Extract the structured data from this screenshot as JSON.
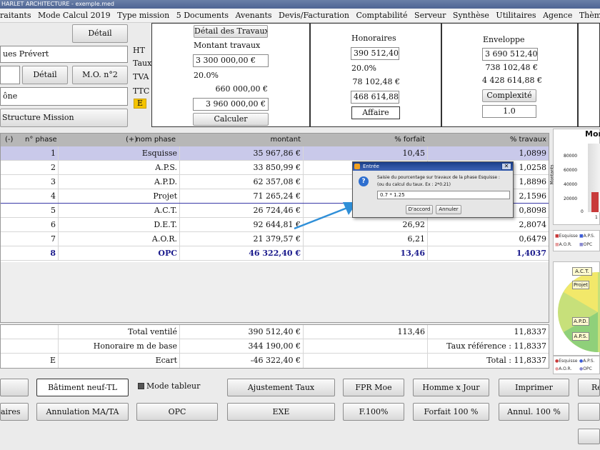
{
  "window": {
    "title": "HARLET ARCHITECTURE - exemple.med"
  },
  "menu": [
    "raitants",
    "Mode Calcul 2019",
    "Type mission",
    "5 Documents",
    "Avenants",
    "Devis/Facturation",
    "Comptabilité",
    "Serveur",
    "Synthèse",
    "Utilitaires",
    "Agence",
    "Thème",
    "?"
  ],
  "left_panel": {
    "detail_button": "Détail",
    "client_name": "ues Prévert",
    "detail_button_2": "Détail",
    "mo_button": "M.O. n°2",
    "city": "ône",
    "structure_button": "Structure Mission"
  },
  "travaux": {
    "detail_button": "Détail des Travaux",
    "montant_label": "Montant travaux",
    "labels": {
      "ht": "HT",
      "taux": "Taux",
      "tva": "TVA",
      "ttc": "TTC",
      "e": "E"
    },
    "ht_value": "3 300 000,00 €",
    "tva_rate": "20.0%",
    "tva_value": "660 000,00 €",
    "ttc_value": "3 960 000,00 €",
    "calc_button": "Calculer"
  },
  "honoraires": {
    "title": "Honoraires",
    "ht_value": "390 512,40 €",
    "tva_rate": "20.0%",
    "tva_value": "78 102,48 €",
    "ttc_value": "468 614,88 €",
    "affaire_button": "Affaire"
  },
  "enveloppe": {
    "title": "Enveloppe",
    "ht_value": "3 690 512,40 €",
    "tva_value": "738 102,48 €",
    "ttc_value": "4 428 614,88 €",
    "complexite_button": "Complexité",
    "complexite_value": "1.0"
  },
  "table": {
    "headers": [
      "(-)",
      "n° phase",
      "(+)",
      "nom phase",
      "montant",
      "% forfait",
      "% travaux"
    ],
    "rows": [
      {
        "num": "1",
        "name": "Esquisse",
        "montant": "35 967,86 €",
        "forfait": "10,45",
        "travaux": "1,0899"
      },
      {
        "num": "2",
        "name": "A.P.S.",
        "montant": "33 850,99 €",
        "forfait": "",
        "travaux": "1,0258"
      },
      {
        "num": "3",
        "name": "A.P.D.",
        "montant": "62 357,08 €",
        "forfait": "",
        "travaux": "1,8896"
      },
      {
        "num": "4",
        "name": "Projet",
        "montant": "71 265,24 €",
        "forfait": "",
        "travaux": "2,1596"
      },
      {
        "num": "5",
        "name": "A.C.T.",
        "montant": "26 724,46 €",
        "forfait": "",
        "travaux": "0,8098"
      },
      {
        "num": "6",
        "name": "D.E.T.",
        "montant": "92 644,81 €",
        "forfait": "26,92",
        "travaux": "2,8074"
      },
      {
        "num": "7",
        "name": "A.O.R.",
        "montant": "21 379,57 €",
        "forfait": "6,21",
        "travaux": "0,6479"
      },
      {
        "num": "8",
        "name": "OPC",
        "montant": "46 322,40 €",
        "forfait": "13,46",
        "travaux": "1,4037"
      }
    ]
  },
  "totals": {
    "row1": {
      "label": "Total ventilé",
      "montant": "390 512,40 €",
      "forfait": "113,46",
      "travaux": "11,8337"
    },
    "row2": {
      "label": "Honoraire m de base",
      "montant": "344 190,00 €",
      "right": "Taux référence : 11,8337"
    },
    "row3": {
      "left": "E",
      "label": "Ecart",
      "montant": "-46 322,40 €",
      "right": "Total : 11,8337"
    }
  },
  "buttons_row1": [
    "Bâtiment neuf-TL",
    "Mode tableur",
    "Ajustement Taux",
    "FPR Moe",
    "Homme x Jour",
    "Imprimer",
    "Ré"
  ],
  "buttons_row2": [
    "aires",
    "Annulation MA/TA",
    "OPC",
    "EXE",
    "F.100%",
    "Forfait 100 %",
    "Annul. 100 %"
  ],
  "dialog": {
    "title": "Entrée",
    "message_line1": "Saisie du pourcentage sur travaux de la phase Esquisse :",
    "message_line2": "(ou du calcul du taux. Ex : 2*0.21)",
    "input_value": "0.7 * 1.25",
    "ok_button": "D'accord",
    "cancel_button": "Annuler",
    "close_glyph": "✕"
  },
  "bar_chart": {
    "title": "Mon",
    "ylabel": "Montants",
    "ticks": [
      "80000",
      "60000",
      "40000",
      "20000",
      "0"
    ],
    "xtick": "1",
    "legend": [
      "Esquisse",
      "A.P.S.",
      "A.O.R.",
      "OPC"
    ]
  },
  "pie_chart": {
    "labels": [
      "A.C.T.",
      "Projet",
      "A.P.D.",
      "A.P.S."
    ],
    "legend": [
      "Esquisse",
      "A.P.S.",
      "A.O.R.",
      "OPC"
    ]
  },
  "colors": {
    "header_bg": "#b7b7b7",
    "selected_row": "#c9c9ea",
    "opc_text": "#1a1a8c",
    "arrow": "#2f8fd8",
    "e_badge": "#f4c400"
  }
}
